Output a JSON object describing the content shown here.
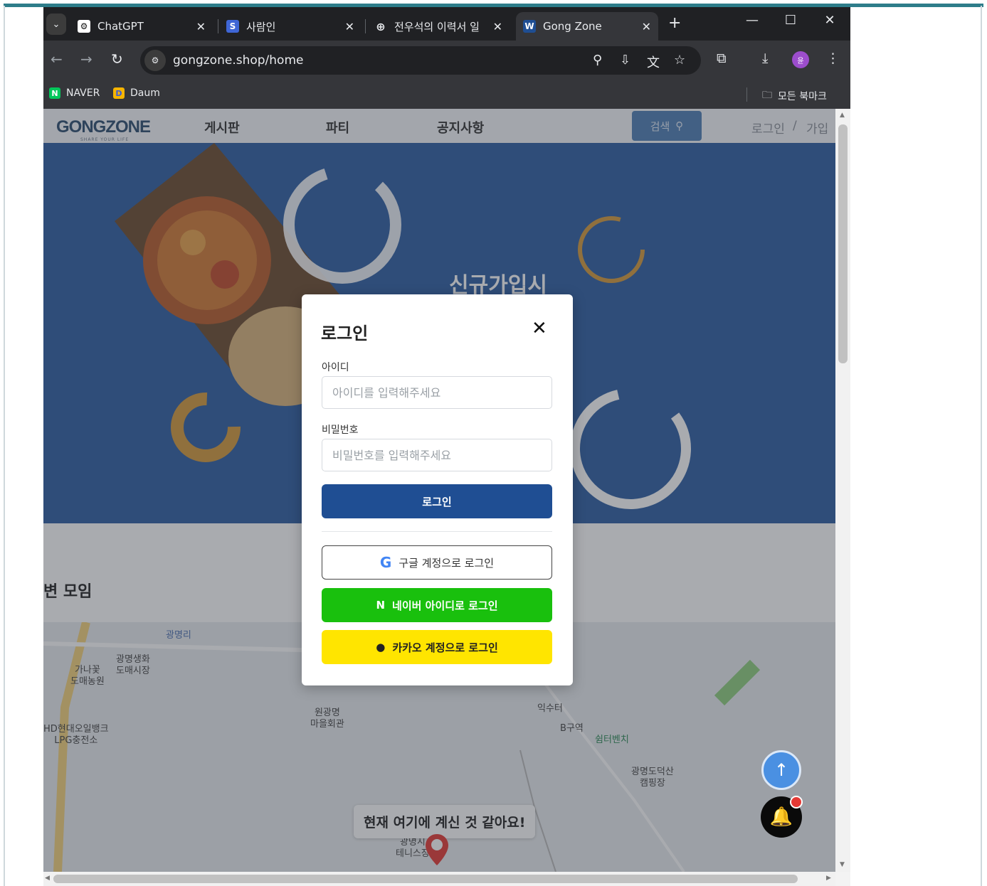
{
  "browser": {
    "tabs": [
      {
        "title": "ChatGPT",
        "favicon": "chatgpt-icon"
      },
      {
        "title": "사람인",
        "favicon": "saramin-icon"
      },
      {
        "title": "전우석의 이력서 일",
        "favicon": "globe-icon"
      },
      {
        "title": "Gong Zone",
        "favicon": "gongzone-icon",
        "active": true
      }
    ],
    "url": "gongzone.shop/home",
    "bookmarks": [
      {
        "label": "NAVER",
        "icon": "naver-icon",
        "color": "#03c75a"
      },
      {
        "label": "Daum",
        "icon": "daum-icon",
        "color": "#f5b400"
      }
    ],
    "all_bookmarks": "모든 북마크",
    "profile_initial": "윤"
  },
  "site": {
    "logo": "GONGZONE",
    "logo_sub": "SHARE YOUR LIFE",
    "nav": [
      "게시판",
      "파티",
      "공지사항"
    ],
    "search_label": "검색",
    "login_link": "로그인",
    "separator": "/",
    "signup_link": "가입",
    "hero_text": "신규가입시",
    "section_title": "변 모임",
    "location_pill": "현재 여기에 계신 것 같아요!",
    "map_labels": [
      "광명리",
      "가나꽃\n도매농원",
      "광명생화\n도매시장",
      "원광명\n마을회관",
      "HD현대오일뱅크\nLPG충전소",
      "익수터",
      "B구역",
      "쉼터벤치",
      "광명도덕산\n캠핑장",
      "광명시\n테니스장"
    ]
  },
  "modal": {
    "title": "로그인",
    "id_label": "아이디",
    "id_placeholder": "아이디를 입력해주세요",
    "pw_label": "비밀번호",
    "pw_placeholder": "비밀번호를 입력해주세요",
    "login_button": "로그인",
    "google_button": "구글 계정으로 로그인",
    "naver_button": "네이버 아이디로 로그인",
    "kakao_button": "카카오 계정으로 로그인"
  },
  "colors": {
    "accent": "#1f4e93",
    "hero": "#2e5ea3",
    "naver": "#19c00d",
    "kakao": "#ffe500"
  }
}
